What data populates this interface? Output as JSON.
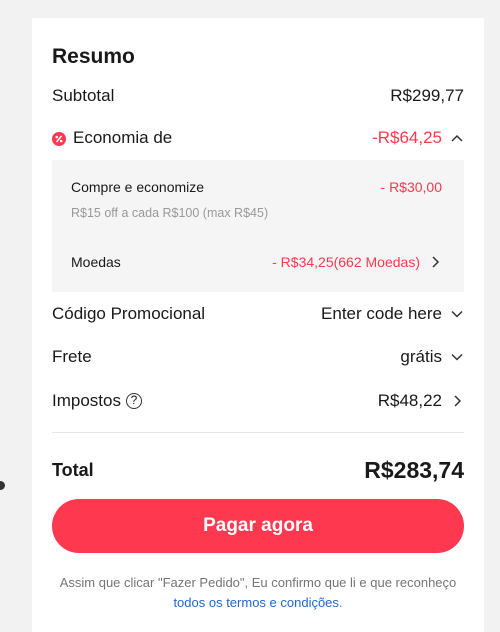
{
  "summary": {
    "title": "Resumo",
    "subtotal_label": "Subtotal",
    "subtotal_value": "R$299,77",
    "savings_label": "Economia de",
    "savings_value": "-R$64,25",
    "savings_details": {
      "deal_label": "Compre e economize",
      "deal_value": "- R$30,00",
      "deal_note": "R$15 off a cada R$100 (max R$45)",
      "coins_label": "Moedas",
      "coins_value": "- R$34,25(662 Moedas)"
    },
    "promo_label": "Código Promocional",
    "promo_placeholder": "Enter code here",
    "shipping_label": "Frete",
    "shipping_value": "grátis",
    "taxes_label": "Impostos",
    "taxes_help": "?",
    "taxes_value": "R$48,22",
    "total_label": "Total",
    "total_value": "R$283,74",
    "pay_button": "Pagar agora",
    "legal_text": "Assim que clicar \"Fazer Pedido\", Eu confirmo que li e que reconheço",
    "legal_link": "todos os termos e condições",
    "legal_end": "."
  },
  "colors": {
    "accent": "#fd384f",
    "link": "#2266cc",
    "muted": "#999999"
  },
  "icons": {
    "savings": "discount-badge-icon",
    "expand": "chevron-up-icon",
    "dropdown": "chevron-down-icon",
    "navigate": "chevron-right-icon",
    "help": "question-circle-icon"
  }
}
